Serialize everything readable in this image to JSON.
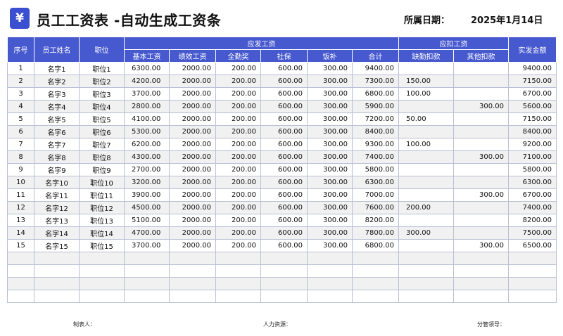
{
  "header": {
    "logo_glyph": "¥",
    "title": "员工工资表 -自动生成工资条",
    "date_label": "所属日期：",
    "date_value": "2025年1月14日"
  },
  "columns": {
    "seq": "序号",
    "name": "员工姓名",
    "position": "职位",
    "group_payable": "应发工资",
    "group_deduct": "应扣工资",
    "base": "基本工资",
    "perf": "绩效工资",
    "attendance": "全勤奖",
    "social": "社保",
    "meal": "饭补",
    "total": "合计",
    "absence": "缺勤扣款",
    "other": "其他扣款",
    "net": "实发金额"
  },
  "rows": [
    {
      "seq": "1",
      "name": "名字1",
      "position": "职位1",
      "base": "6300.00",
      "perf": "2000.00",
      "attendance": "200.00",
      "social": "600.00",
      "meal": "300.00",
      "total": "9400.00",
      "absence": "",
      "other": "",
      "net": "9400.00"
    },
    {
      "seq": "2",
      "name": "名字2",
      "position": "职位2",
      "base": "4200.00",
      "perf": "2000.00",
      "attendance": "200.00",
      "social": "600.00",
      "meal": "300.00",
      "total": "7300.00",
      "absence": "150.00",
      "other": "",
      "net": "7150.00"
    },
    {
      "seq": "3",
      "name": "名字3",
      "position": "职位3",
      "base": "3700.00",
      "perf": "2000.00",
      "attendance": "200.00",
      "social": "600.00",
      "meal": "300.00",
      "total": "6800.00",
      "absence": "100.00",
      "other": "",
      "net": "6700.00"
    },
    {
      "seq": "4",
      "name": "名字4",
      "position": "职位4",
      "base": "2800.00",
      "perf": "2000.00",
      "attendance": "200.00",
      "social": "600.00",
      "meal": "300.00",
      "total": "5900.00",
      "absence": "",
      "other": "300.00",
      "net": "5600.00"
    },
    {
      "seq": "5",
      "name": "名字5",
      "position": "职位5",
      "base": "4100.00",
      "perf": "2000.00",
      "attendance": "200.00",
      "social": "600.00",
      "meal": "300.00",
      "total": "7200.00",
      "absence": "50.00",
      "other": "",
      "net": "7150.00"
    },
    {
      "seq": "6",
      "name": "名字6",
      "position": "职位6",
      "base": "5300.00",
      "perf": "2000.00",
      "attendance": "200.00",
      "social": "600.00",
      "meal": "300.00",
      "total": "8400.00",
      "absence": "",
      "other": "",
      "net": "8400.00"
    },
    {
      "seq": "7",
      "name": "名字7",
      "position": "职位7",
      "base": "6200.00",
      "perf": "2000.00",
      "attendance": "200.00",
      "social": "600.00",
      "meal": "300.00",
      "total": "9300.00",
      "absence": "100.00",
      "other": "",
      "net": "9200.00"
    },
    {
      "seq": "8",
      "name": "名字8",
      "position": "职位8",
      "base": "4300.00",
      "perf": "2000.00",
      "attendance": "200.00",
      "social": "600.00",
      "meal": "300.00",
      "total": "7400.00",
      "absence": "",
      "other": "300.00",
      "net": "7100.00"
    },
    {
      "seq": "9",
      "name": "名字9",
      "position": "职位9",
      "base": "2700.00",
      "perf": "2000.00",
      "attendance": "200.00",
      "social": "600.00",
      "meal": "300.00",
      "total": "5800.00",
      "absence": "",
      "other": "",
      "net": "5800.00"
    },
    {
      "seq": "10",
      "name": "名字10",
      "position": "职位10",
      "base": "3200.00",
      "perf": "2000.00",
      "attendance": "200.00",
      "social": "600.00",
      "meal": "300.00",
      "total": "6300.00",
      "absence": "",
      "other": "",
      "net": "6300.00"
    },
    {
      "seq": "11",
      "name": "名字11",
      "position": "职位11",
      "base": "3900.00",
      "perf": "2000.00",
      "attendance": "200.00",
      "social": "600.00",
      "meal": "300.00",
      "total": "7000.00",
      "absence": "",
      "other": "300.00",
      "net": "6700.00"
    },
    {
      "seq": "12",
      "name": "名字12",
      "position": "职位12",
      "base": "4500.00",
      "perf": "2000.00",
      "attendance": "200.00",
      "social": "600.00",
      "meal": "300.00",
      "total": "7600.00",
      "absence": "200.00",
      "other": "",
      "net": "7400.00"
    },
    {
      "seq": "13",
      "name": "名字13",
      "position": "职位13",
      "base": "5100.00",
      "perf": "2000.00",
      "attendance": "200.00",
      "social": "600.00",
      "meal": "300.00",
      "total": "8200.00",
      "absence": "",
      "other": "",
      "net": "8200.00"
    },
    {
      "seq": "14",
      "name": "名字14",
      "position": "职位14",
      "base": "4700.00",
      "perf": "2000.00",
      "attendance": "200.00",
      "social": "600.00",
      "meal": "300.00",
      "total": "7800.00",
      "absence": "300.00",
      "other": "",
      "net": "7500.00"
    },
    {
      "seq": "15",
      "name": "名字15",
      "position": "职位15",
      "base": "3700.00",
      "perf": "2000.00",
      "attendance": "200.00",
      "social": "600.00",
      "meal": "300.00",
      "total": "6800.00",
      "absence": "",
      "other": "300.00",
      "net": "6500.00"
    }
  ],
  "empty_rows": 4,
  "footer": {
    "maker": "制表人：",
    "hr": "人力资源：",
    "leader": "分管领导："
  },
  "colors": {
    "header_bg": "#4759cf",
    "logo_bg": "#3b4fd1",
    "stripe": "#f1f1f1",
    "grid": "#b9bfd6"
  }
}
